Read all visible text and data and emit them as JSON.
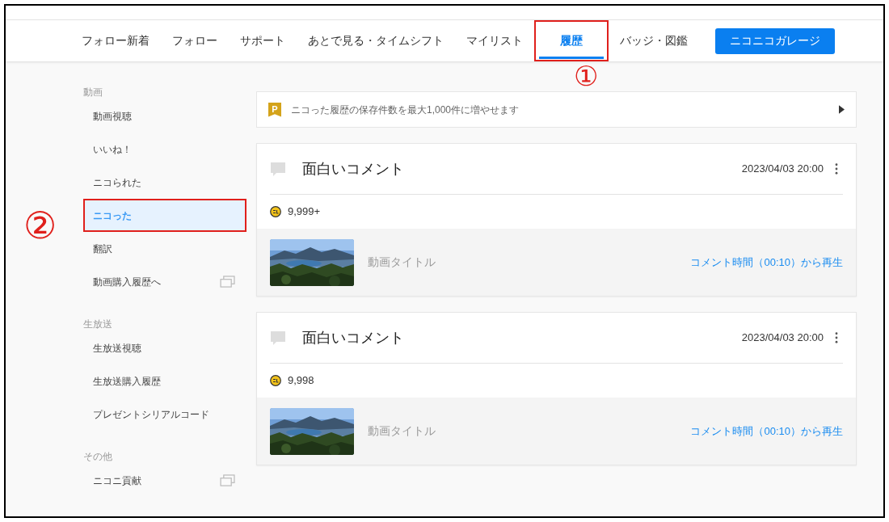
{
  "nav": {
    "tabs": [
      {
        "label": "フォロー新着",
        "selected": false,
        "highlighted": false
      },
      {
        "label": "フォロー",
        "selected": false,
        "highlighted": false
      },
      {
        "label": "サポート",
        "selected": false,
        "highlighted": false
      },
      {
        "label": "あとで見る・タイムシフト",
        "selected": false,
        "highlighted": false
      },
      {
        "label": "マイリスト",
        "selected": false,
        "highlighted": false
      },
      {
        "label": "履歴",
        "selected": true,
        "highlighted": true
      },
      {
        "label": "バッジ・図鑑",
        "selected": false,
        "highlighted": false
      }
    ],
    "garage_button": "ニコニコガレージ"
  },
  "annotations": [
    {
      "label": "①"
    },
    {
      "label": "②"
    }
  ],
  "sidebar": {
    "sections": [
      {
        "heading": "動画",
        "items": [
          {
            "label": "動画視聴",
            "selected": false,
            "highlighted": false,
            "external": false
          },
          {
            "label": "いいね！",
            "selected": false,
            "highlighted": false,
            "external": false
          },
          {
            "label": "ニコられた",
            "selected": false,
            "highlighted": false,
            "external": false
          },
          {
            "label": "ニコった",
            "selected": true,
            "highlighted": true,
            "external": false
          },
          {
            "label": "翻訳",
            "selected": false,
            "highlighted": false,
            "external": false
          },
          {
            "label": "動画購入履歴へ",
            "selected": false,
            "highlighted": false,
            "external": true
          }
        ]
      },
      {
        "heading": "生放送",
        "items": [
          {
            "label": "生放送視聴",
            "selected": false,
            "highlighted": false,
            "external": false
          },
          {
            "label": "生放送購入履歴",
            "selected": false,
            "highlighted": false,
            "external": false
          },
          {
            "label": "プレゼントシリアルコード",
            "selected": false,
            "highlighted": false,
            "external": false
          }
        ]
      },
      {
        "heading": "その他",
        "items": [
          {
            "label": "ニコニ貢献",
            "selected": false,
            "highlighted": false,
            "external": true
          }
        ]
      }
    ]
  },
  "promo": {
    "badge": "P",
    "text": "ニコった履歴の保存件数を最大1,000件に増やせます"
  },
  "cards": [
    {
      "comment": "面白いコメント",
      "date": "2023/04/03 20:00",
      "count": "9,999+",
      "video_title": "動画タイトル",
      "play_link": "コメント時間（00:10）から再生"
    },
    {
      "comment": "面白いコメント",
      "date": "2023/04/03 20:00",
      "count": "9,998",
      "video_title": "動画タイトル",
      "play_link": "コメント時間（00:10）から再生"
    }
  ]
}
